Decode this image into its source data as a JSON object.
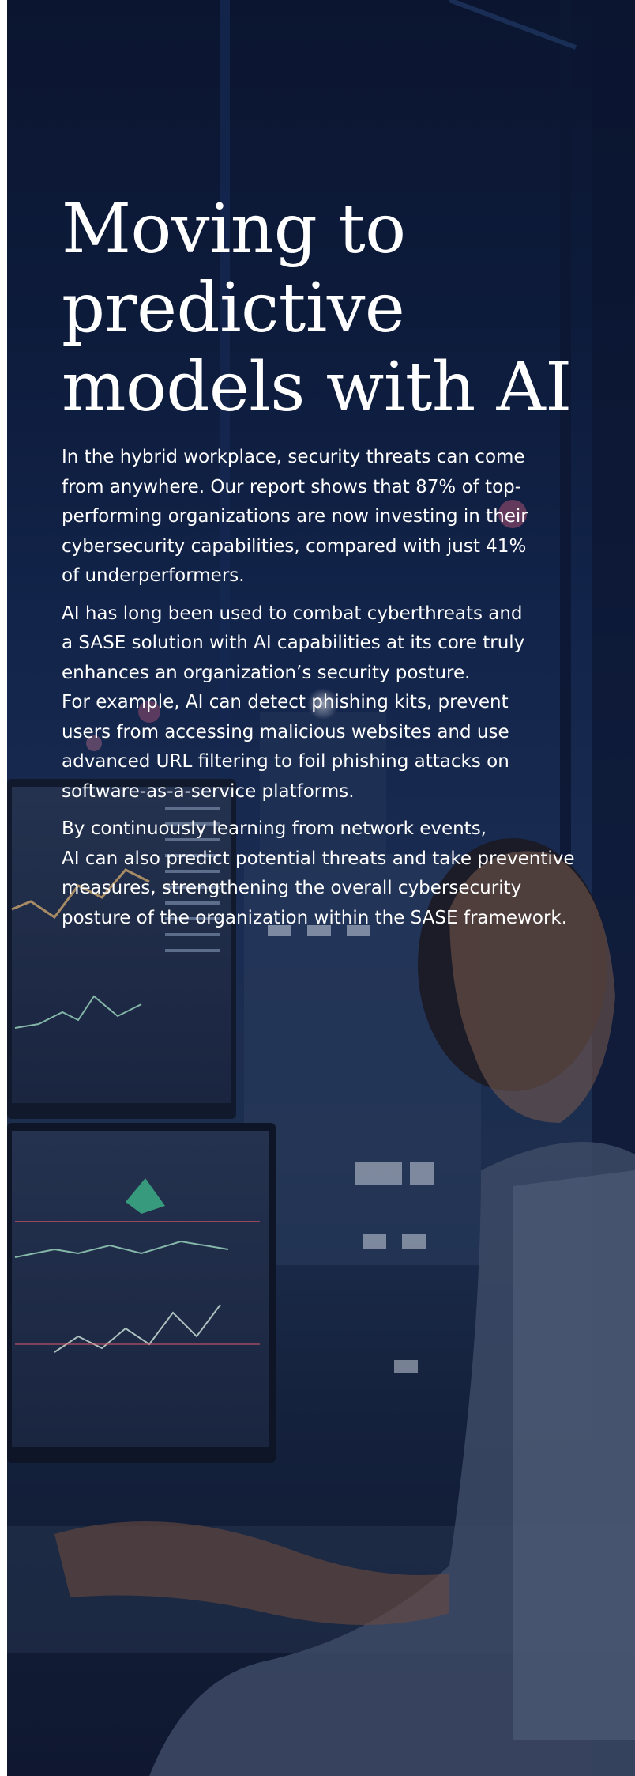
{
  "article": {
    "title_lines": [
      "Moving to",
      "predictive",
      "models with AI"
    ],
    "paragraphs": [
      {
        "lines": [
          "In the hybrid workplace, security threats can come",
          "from anywhere. Our report shows that 87% of top-",
          "performing organizations are now investing in their",
          "cybersecurity capabilities, compared with just 41%",
          "of underperformers."
        ]
      },
      {
        "lines": [
          "AI has long been used to combat cyberthreats and",
          "a SASE solution with AI capabilities at its core truly",
          "enhances an organization’s security posture.",
          "For example, AI can detect phishing kits, prevent",
          "users from accessing malicious websites and use",
          "advanced URL filtering to foil phishing attacks on",
          "software-as-a-service platforms."
        ]
      },
      {
        "lines": [
          "By continuously learning from network events,",
          "AI can also predict potential threats and take preventive",
          "measures, strengthening the overall cybersecurity",
          "posture of the organization within the SASE framework."
        ]
      }
    ]
  },
  "colors": {
    "background_dark": "#0d1b3b",
    "text": "#ffffff"
  }
}
